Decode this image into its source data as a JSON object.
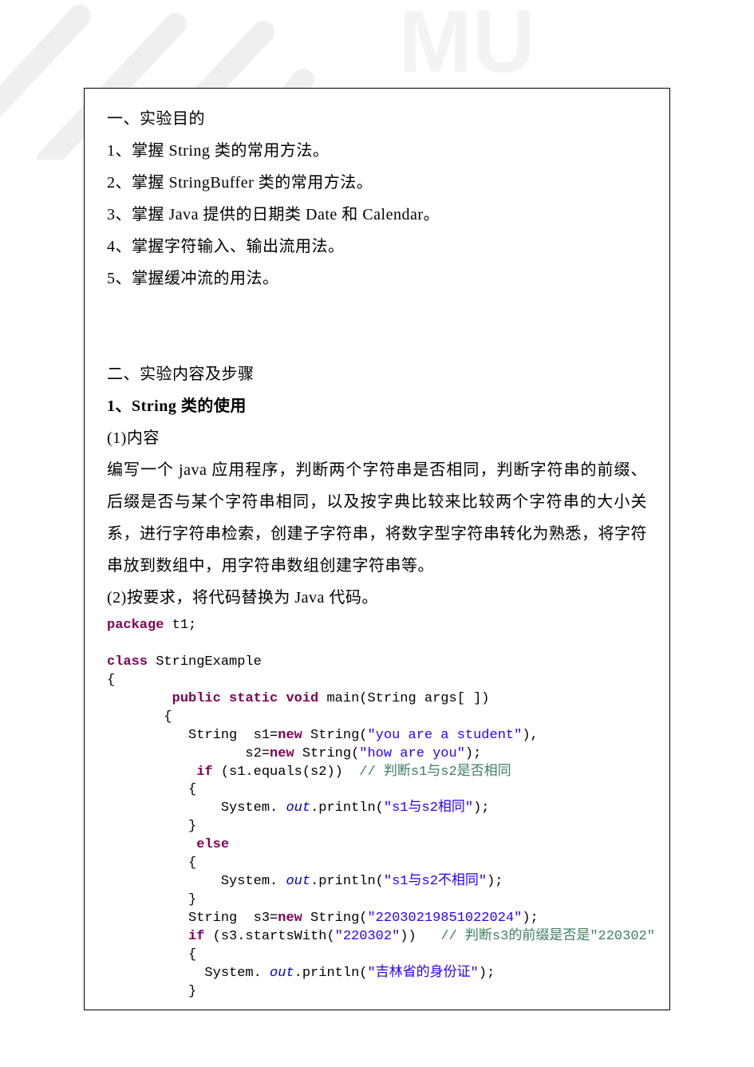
{
  "section1": {
    "title": "一、实验目的",
    "items": [
      "1、掌握 String 类的常用方法。",
      "2、掌握 StringBuffer 类的常用方法。",
      "3、掌握 Java  提供的日期类 Date 和 Calendar。",
      "4、掌握字符输入、输出流用法。",
      "5、掌握缓冲流的用法。"
    ]
  },
  "section2": {
    "title": "二、实验内容及步骤",
    "sub1_title": "1、String 类的使用",
    "content_label": "(1)内容",
    "content_text": "编写一个 java 应用程序，判断两个字符串是否相同，判断字符串的前缀、后缀是否与某个字符串相同，以及按字典比较来比较两个字符串的大小关系，进行字符串检索，创建子字符串，将数字型字符串转化为熟悉，将字符串放到数组中，用字符串数组创建字符串等。",
    "req_label": "  (2)按要求，将代码替换为 Java 代码。"
  },
  "code": {
    "k_package": "package",
    "pkg_name": " t1;",
    "k_class": "class",
    "cls_name": " StringExample",
    "brace_open": "{",
    "k_public_static_void": "public static void",
    "main_sig": " main(String args[ ])",
    "brace_open2": "       {",
    "l_s1a": "          String  s1=",
    "k_new1": "new",
    "l_s1b": " String(",
    "str1": "\"you are a student\"",
    "l_s1c": "),",
    "l_s2a": "                 s2=",
    "k_new2": "new",
    "l_s2b": " String(",
    "str2": "\"how are you\"",
    "l_s2c": ");",
    "l_if1a": "           ",
    "k_if1": "if",
    "l_if1b": " (s1.equals(s2))  ",
    "cmt1": "// 判断s1与s2是否相同",
    "l_b1o": "          {",
    "l_p1a": "              System.",
    "f_out1": " out",
    "l_p1b": ".println(",
    "str3": "\"s1与s2相同\"",
    "l_p1c": ");",
    "l_b1c": "          }",
    "l_else_sp": "           ",
    "k_else": "else",
    "l_b2o": "          {",
    "l_p2a": "              System.",
    "f_out2": " out",
    "l_p2b": ".println(",
    "str4": "\"s1与s2不相同\"",
    "l_p2c": ");",
    "l_b2c": "          }",
    "l_s3a": "          String  s3=",
    "k_new3": "new",
    "l_s3b": " String(",
    "str5": "\"22030219851022024\"",
    "l_s3c": ");",
    "l_if2a": "          ",
    "k_if2": "if",
    "l_if2b": " (s3.startsWith(",
    "str6": "\"220302\"",
    "l_if2c": "))   ",
    "cmt2": "// 判断s3的前缀是否是\"220302\"",
    "l_b3o": "          {",
    "l_p3a": "            System.",
    "f_out3": " out",
    "l_p3b": ".println(",
    "str7": "\"吉林省的身份证\"",
    "l_p3c": ");",
    "l_b3c": "          }"
  }
}
